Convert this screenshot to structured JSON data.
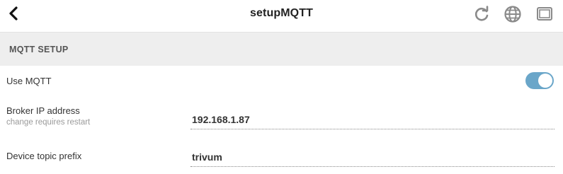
{
  "header": {
    "title": "setupMQTT",
    "back_icon": "chevron-left-icon",
    "actions": [
      "refresh-icon",
      "globe-icon",
      "window-icon"
    ]
  },
  "section": {
    "title": "MQTT SETUP"
  },
  "settings": {
    "use_mqtt": {
      "label": "Use MQTT",
      "enabled": true
    },
    "broker_ip": {
      "label": "Broker IP address",
      "hint": "change requires restart",
      "value": "192.168.1.87"
    },
    "topic_prefix": {
      "label": "Device topic prefix",
      "value": "trivum"
    }
  },
  "colors": {
    "toggle_on": "#6aa6c9",
    "section_bg": "#eeeeee",
    "icon_gray": "#8a8a8a"
  }
}
